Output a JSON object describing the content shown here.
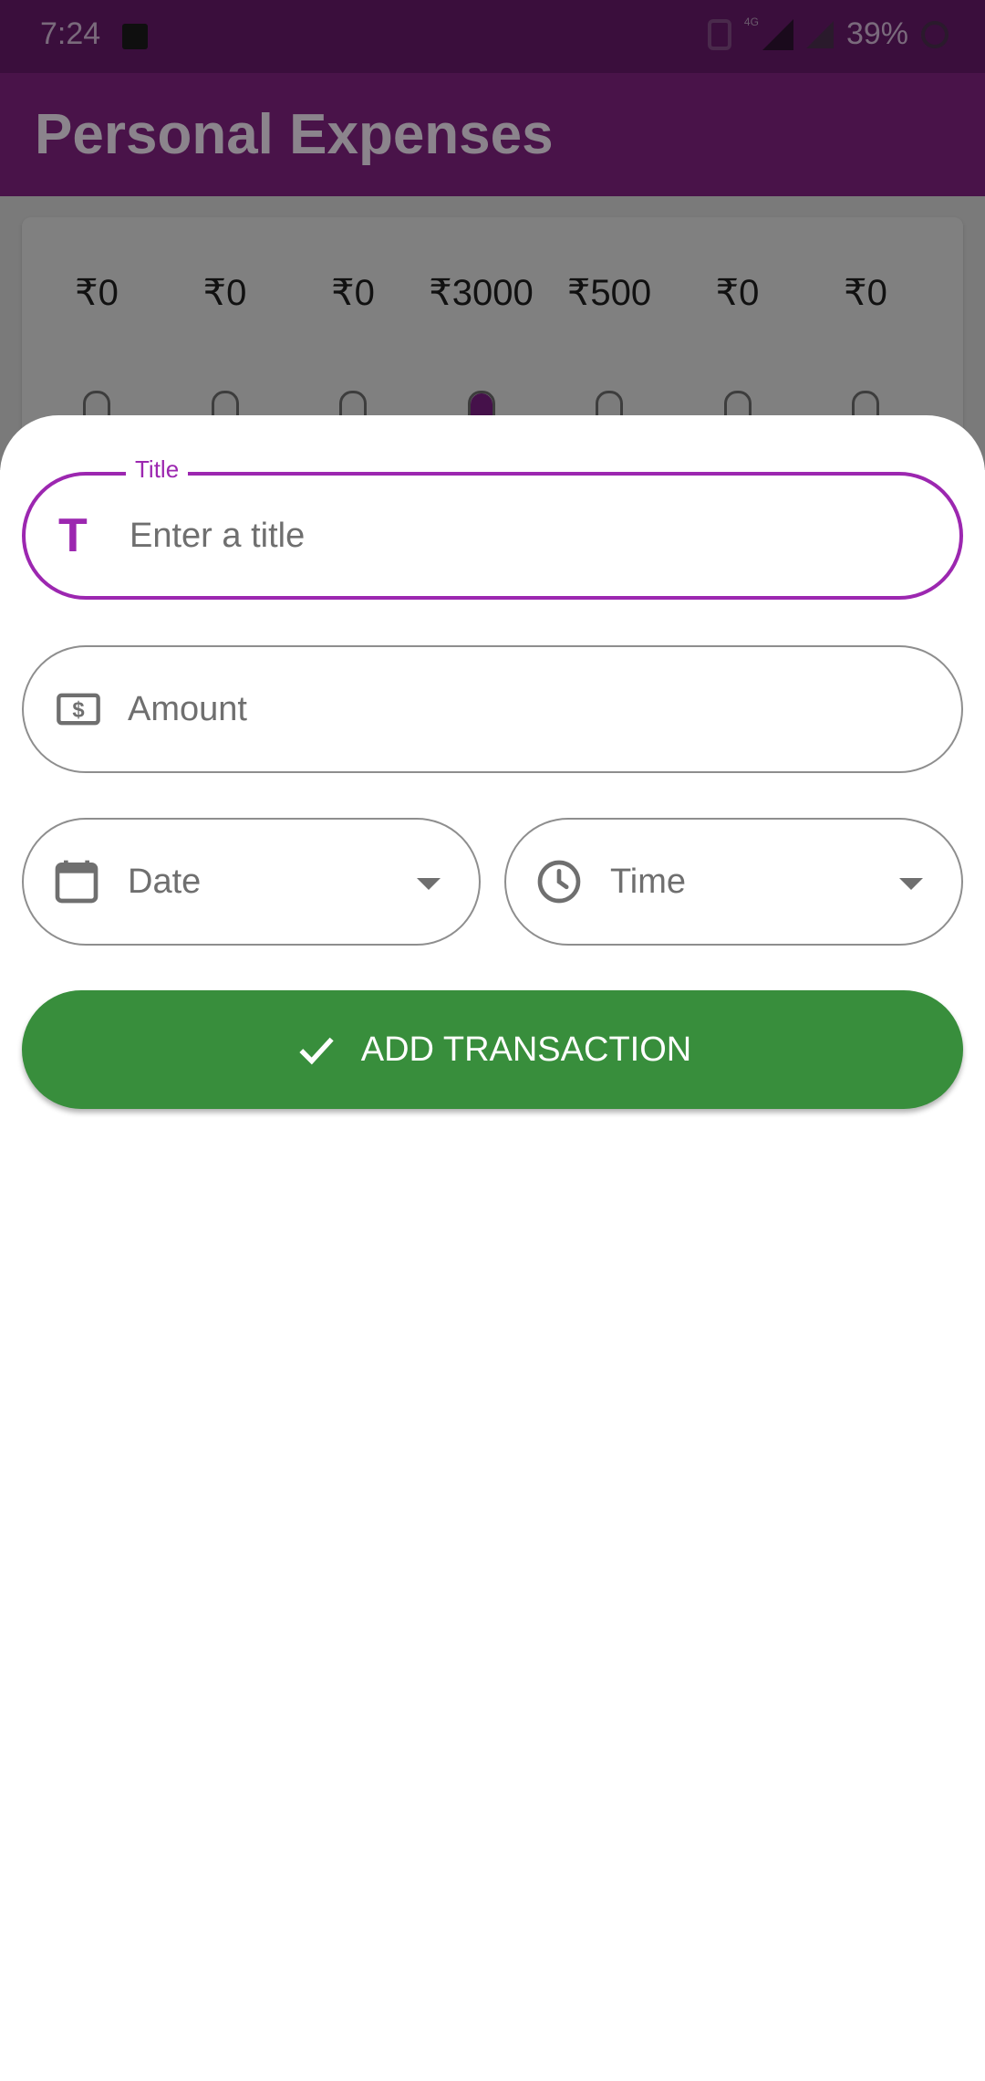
{
  "status_bar": {
    "time": "7:24",
    "network": "4G",
    "battery": "39%"
  },
  "app_bar": {
    "title": "Personal Expenses"
  },
  "chart_data": {
    "type": "bar",
    "categories": [
      "",
      "",
      "",
      "",
      "",
      "",
      ""
    ],
    "values": [
      0,
      0,
      0,
      3000,
      500,
      0,
      0
    ],
    "labels": [
      "₹0",
      "₹0",
      "₹0",
      "₹3000",
      "₹500",
      "₹0",
      "₹0"
    ]
  },
  "form": {
    "title_field": {
      "label": "Title",
      "placeholder": "Enter a title",
      "icon": "T"
    },
    "amount_field": {
      "placeholder": "Amount"
    },
    "date_field": {
      "placeholder": "Date"
    },
    "time_field": {
      "placeholder": "Time"
    },
    "submit_label": "ADD TRANSACTION"
  },
  "colors": {
    "accent": "#9c27b0",
    "app_bar": "#491349",
    "submit": "#388e3c"
  }
}
